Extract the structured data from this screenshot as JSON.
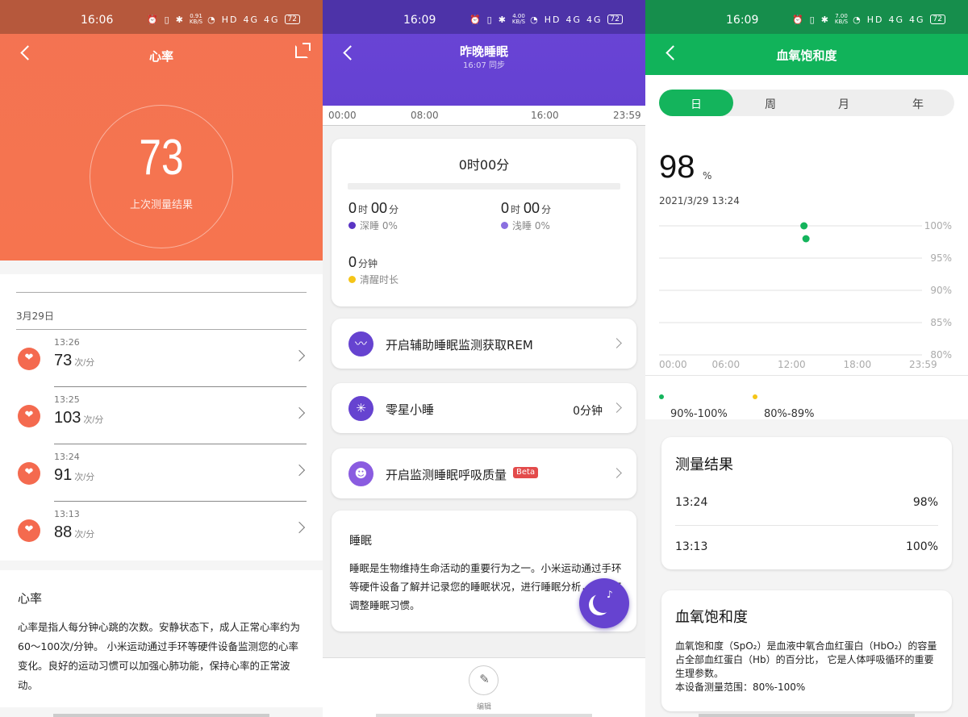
{
  "status": [
    {
      "time": "16:06",
      "speed": "0.91",
      "speed_unit": "KB/S",
      "hd": "HD",
      "sig": "4G",
      "battery": "72"
    },
    {
      "time": "16:09",
      "speed": "4.00",
      "speed_unit": "KB/S",
      "hd": "HD",
      "sig": "4G",
      "battery": "72"
    },
    {
      "time": "16:09",
      "speed": "7.00",
      "speed_unit": "KB/S",
      "hd": "HD",
      "sig": "4G",
      "battery": "72"
    }
  ],
  "heart": {
    "title": "心率",
    "latest_value": "73",
    "latest_label": "上次测量结果",
    "date": "3月29日",
    "unit": "次/分",
    "records": [
      {
        "time": "13:26",
        "value": "73"
      },
      {
        "time": "13:25",
        "value": "103"
      },
      {
        "time": "13:24",
        "value": "91"
      },
      {
        "time": "13:13",
        "value": "88"
      }
    ],
    "info_title": "心率",
    "info_text": "心率是指人每分钟心跳的次数。安静状态下，成人正常心率约为60～100次/分钟。 小米运动通过手环等硬件设备监测您的心率变化。良好的运动习惯可以加强心肺功能，保持心率的正常波动。"
  },
  "sleep": {
    "title": "昨晚睡眠",
    "sync": "16:07 同步",
    "timeline": [
      "00:00",
      "08:00",
      "16:00",
      "23:59"
    ],
    "total": "0时00分",
    "deep": {
      "h": "0",
      "h_unit": "时",
      "m": "00",
      "m_unit": "分",
      "label": "深睡 0%",
      "color": "#5a35c4"
    },
    "light": {
      "h": "0",
      "h_unit": "时",
      "m": "00",
      "m_unit": "分",
      "label": "浅睡 0%",
      "color": "#8a6fe0"
    },
    "awake": {
      "m": "0",
      "m_unit": "分钟",
      "label": "清醒时长",
      "color": "#f5c518"
    },
    "rows": [
      {
        "label": "开启辅助睡眠监测获取REM",
        "value": ""
      },
      {
        "label": "零星小睡",
        "value": "0分钟"
      },
      {
        "label": "开启监测睡眠呼吸质量",
        "value": "",
        "badge": "Beta"
      }
    ],
    "about_title": "睡眠",
    "about_text": "睡眠是生物维持生命活动的重要行为之一。小米运动通过手环等硬件设备了解并记录您的睡眠状况，进行睡眠分析，帮助您调整睡眠习惯。",
    "edit_label": "编辑"
  },
  "spo2": {
    "title": "血氧饱和度",
    "tabs": [
      "日",
      "周",
      "月",
      "年"
    ],
    "active_tab": 0,
    "value": "98",
    "unit": "%",
    "timestamp": "2021/3/29 13:24",
    "legend": [
      {
        "label": "90%-100%",
        "color": "#14b45c"
      },
      {
        "label": "80%-89%",
        "color": "#f5c518"
      }
    ],
    "results_title": "测量结果",
    "results": [
      {
        "time": "13:24",
        "value": "98%"
      },
      {
        "time": "13:13",
        "value": "100%"
      }
    ],
    "def_title": "血氧饱和度",
    "def_text": "血氧饱和度（SpO₂）是血液中氧合血红蛋白（HbO₂）的容量占全部血红蛋白（Hb）的百分比， 它是人体呼吸循环的重要生理参数。",
    "def_range": "本设备测量范围：80%-100%",
    "accent": "#14b45c"
  },
  "chart_data": {
    "type": "scatter",
    "title": "",
    "x_ticks": [
      "00:00",
      "06:00",
      "12:00",
      "18:00",
      "23:59"
    ],
    "y_ticks": [
      "100%",
      "95%",
      "90%",
      "85%",
      "80%"
    ],
    "ylim": [
      80,
      100
    ],
    "xlim_minutes": [
      0,
      1439
    ],
    "points": [
      {
        "x": "13:13",
        "y": 100
      },
      {
        "x": "13:24",
        "y": 98
      }
    ],
    "point_color": "#14b45c",
    "grid": true
  }
}
